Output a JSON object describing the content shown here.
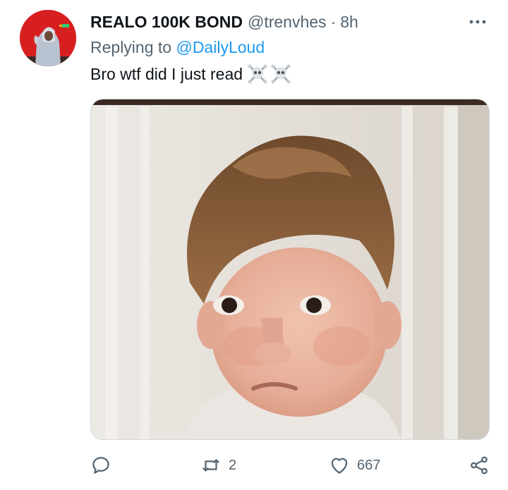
{
  "tweet": {
    "display_name": "REALO 100K BOND",
    "handle": "@trenvhes",
    "separator": "·",
    "time": "8h",
    "replying_prefix": "Replying to ",
    "replying_to": "@DailyLoud",
    "text": "Bro wtf did I just read",
    "emoji": [
      "skull-and-crossbones",
      "skull-and-crossbones"
    ]
  },
  "actions": {
    "reply_count": "",
    "retweet_count": "2",
    "like_count": "667"
  },
  "icons": {
    "more": "more-horizontal-icon",
    "reply": "reply-icon",
    "retweet": "retweet-icon",
    "like": "heart-icon",
    "share": "share-icon"
  },
  "colors": {
    "link": "#1d9bf0",
    "secondary_text": "#536471",
    "primary_text": "#0f1419",
    "avatar_bg": "#d81f1f"
  }
}
